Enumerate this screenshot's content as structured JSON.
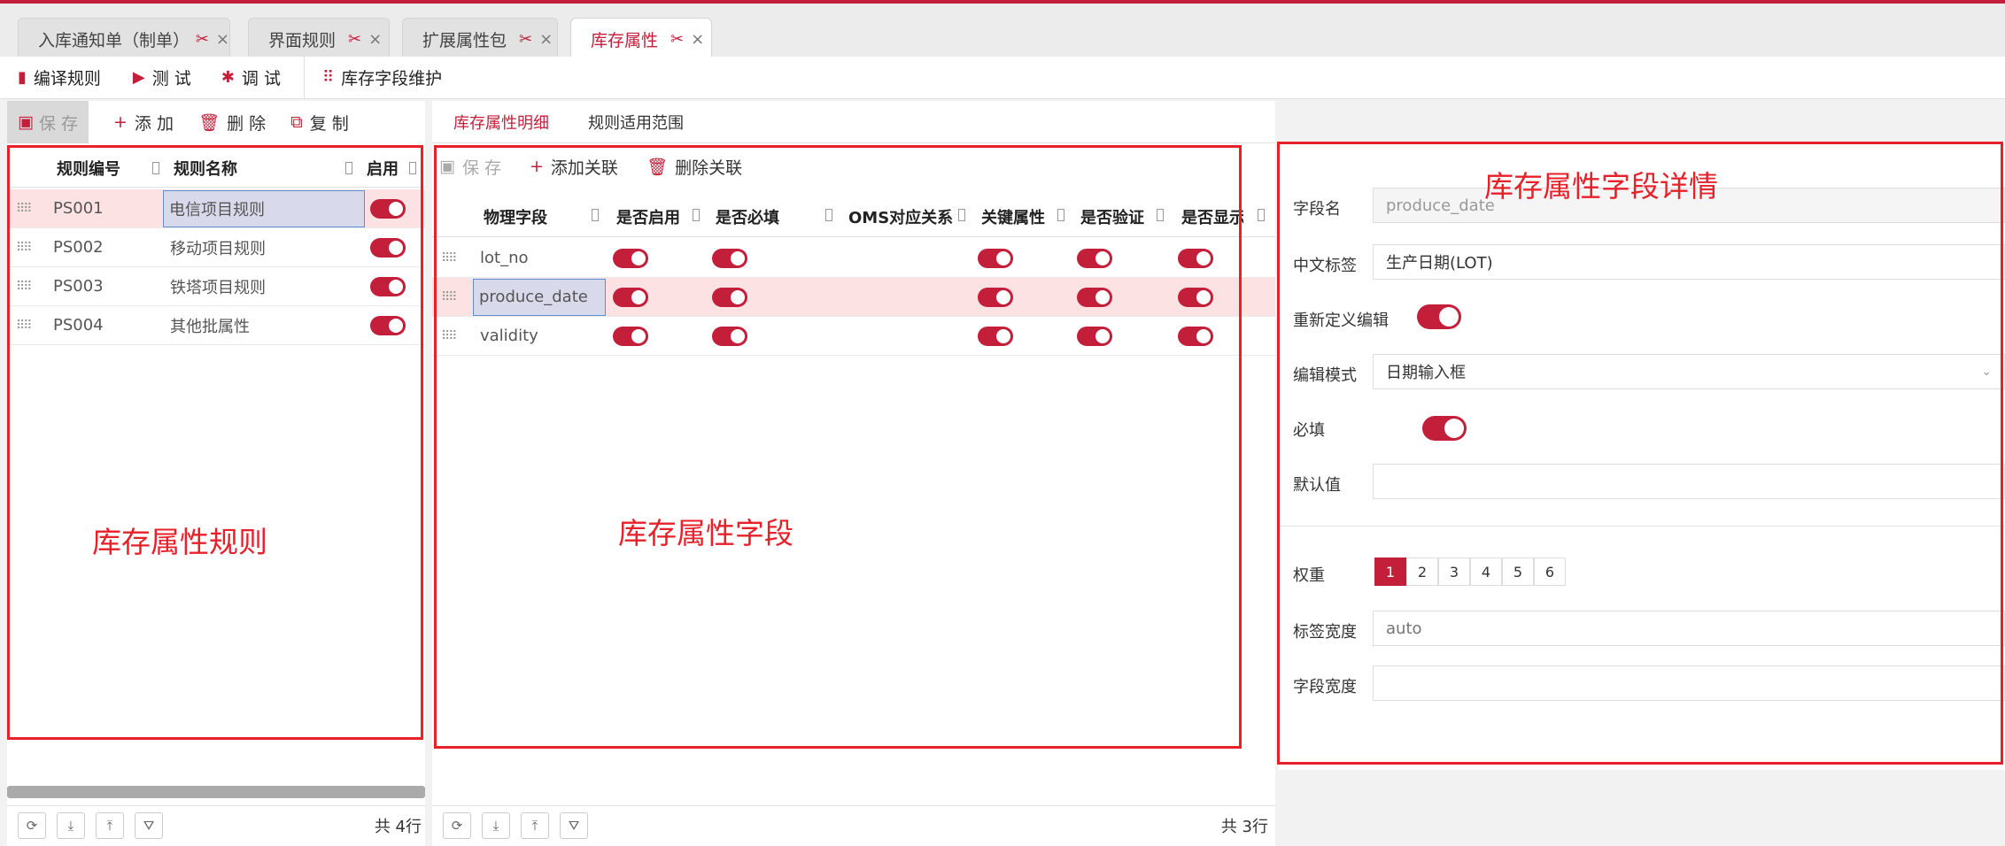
{
  "tabs": [
    {
      "label": "入库通知单（制单）",
      "active": false
    },
    {
      "label": "界面规则",
      "active": false
    },
    {
      "label": "扩展属性包",
      "active": false
    },
    {
      "label": "库存属性",
      "active": true
    }
  ],
  "toolbar": {
    "compile": "编译规则",
    "test": "测 试",
    "debug": "调 试",
    "maintain": "库存字段维护"
  },
  "left": {
    "actions": {
      "save": "保 存",
      "add": "添 加",
      "delete": "删 除",
      "copy": "复 制"
    },
    "columns": {
      "code": "规则编号",
      "name": "规则名称",
      "enabled": "启用"
    },
    "rows": [
      {
        "code": "PS001",
        "name": "电信项目规则",
        "enabled": true
      },
      {
        "code": "PS002",
        "name": "移动项目规则",
        "enabled": true
      },
      {
        "code": "PS003",
        "name": "铁塔项目规则",
        "enabled": true
      },
      {
        "code": "PS004",
        "name": "其他批属性",
        "enabled": true
      }
    ],
    "footer_count": "共 4行",
    "annotation": "库存属性规则"
  },
  "middle": {
    "subtabs": [
      "库存属性明细",
      "规则适用范围"
    ],
    "actions": {
      "save": "保 存",
      "add_link": "添加关联",
      "delete_link": "删除关联"
    },
    "columns": {
      "field": "物理字段",
      "enabled": "是否启用",
      "required": "是否必填",
      "oms": "OMS对应关系",
      "key": "关键属性",
      "verify": "是否验证",
      "display": "是否显示"
    },
    "rows": [
      {
        "field": "lot_no"
      },
      {
        "field": "produce_date"
      },
      {
        "field": "validity"
      }
    ],
    "footer_count": "共 3行",
    "annotation": "库存属性字段"
  },
  "right": {
    "annotation": "库存属性字段详情",
    "field_name_label": "字段名",
    "field_name_value": "produce_date",
    "cn_label_label": "中文标签",
    "cn_label_value": "生产日期(LOT)",
    "redefine_label": "重新定义编辑",
    "edit_mode_label": "编辑模式",
    "edit_mode_value": "日期输入框",
    "required_label": "必填",
    "default_label": "默认值",
    "default_value": "",
    "weight_label": "权重",
    "weights": [
      "1",
      "2",
      "3",
      "4",
      "5",
      "6"
    ],
    "label_width_label": "标签宽度",
    "label_width_placeholder": "auto",
    "field_width_label": "字段宽度",
    "field_width_value": ""
  },
  "colors": {
    "accent": "#c41f3a",
    "annotation": "#e8202a"
  }
}
